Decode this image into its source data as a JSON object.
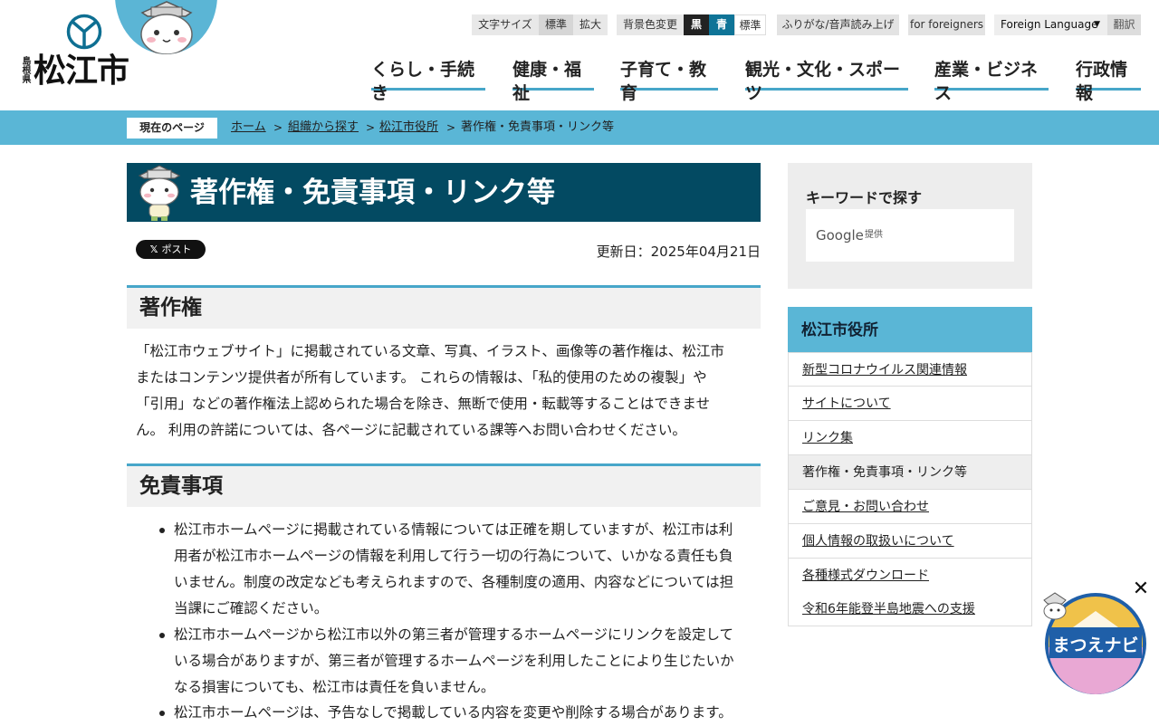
{
  "header": {
    "logo_pref": "島根県",
    "logo_city": "松江市"
  },
  "toolbar": {
    "font_size_label": "文字サイズ",
    "font_standard": "標準",
    "font_large": "拡大",
    "bg_label": "背景色変更",
    "bg_black": "黒",
    "bg_blue": "青",
    "bg_standard": "標準",
    "furigana": "ふりがな/音声読み上げ",
    "for_foreigners": "for foreigners",
    "foreign_language": "Foreign Language",
    "translate": "翻訳"
  },
  "global_nav": [
    "くらし・手続き",
    "健康・福祉",
    "子育て・教育",
    "観光・文化・スポーツ",
    "産業・ビジネス",
    "行政情報"
  ],
  "breadcrumb": {
    "here_label": "現在のページ",
    "items": [
      "ホーム",
      "組織から探す",
      "松江市役所",
      "著作権・免責事項・リンク等"
    ]
  },
  "main": {
    "title": "著作権・免責事項・リンク等",
    "tweet_label": "ポスト",
    "updated": "更新日：2025年04月21日",
    "sections": [
      {
        "heading": "著作権",
        "lines": [
          "「松江市ウェブサイト」に掲載されている文章、写真、イラスト、画像等の著作権は、松江市",
          "またはコンテンツ提供者が所有しています。 これらの情報は、「私的使用のための複製」や",
          "「引用」などの著作権法上認められた場合を除き、無断で使用・転載等することはできませ",
          "ん。 利用の許諾については、各ページに記載されている課等へお問い合わせください。"
        ]
      },
      {
        "heading": "免責事項",
        "bullets": [
          [
            "松江市ホームページに掲載されている情報については正確を期していますが、松江市は利",
            "用者が松江市ホームページの情報を利用して行う一切の行為について、いかなる責任も負",
            "いません。制度の改定なども考えられますので、各種制度の適用、内容などについては担",
            "当課にご確認ください。"
          ],
          [
            "松江市ホームページから松江市以外の第三者が管理するホームページにリンクを設定して",
            "いる場合がありますが、第三者が管理するホームページを利用したことにより生じたいか",
            "なる損害についても、松江市は責任を負いません。"
          ],
          [
            "松江市ホームページは、予告なしで掲載している内容を変更や削除する場合があります。"
          ]
        ]
      }
    ]
  },
  "sidebar": {
    "search_heading": "キーワードで探す",
    "google_label": "Google",
    "google_sub": "提供",
    "menu_heading": "松江市役所",
    "items": [
      {
        "label": "新型コロナウイルス関連情報",
        "current": false
      },
      {
        "label": "サイトについて",
        "current": false
      },
      {
        "label": "リンク集",
        "current": false
      },
      {
        "label": "著作権・免責事項・リンク等",
        "current": true
      },
      {
        "label": "ご意見・お問い合わせ",
        "current": false
      },
      {
        "label": "個人情報の取扱いについて",
        "current": false
      },
      {
        "label": "各種様式ダウンロード",
        "current": false
      },
      {
        "label": "令和6年能登半島地震への支援",
        "current": false
      }
    ]
  },
  "floating": {
    "navi_label": "まつえナビ"
  },
  "colors": {
    "accent": "#5ab6d6",
    "title_bg": "#034a62",
    "section_border": "#47a6c9"
  }
}
